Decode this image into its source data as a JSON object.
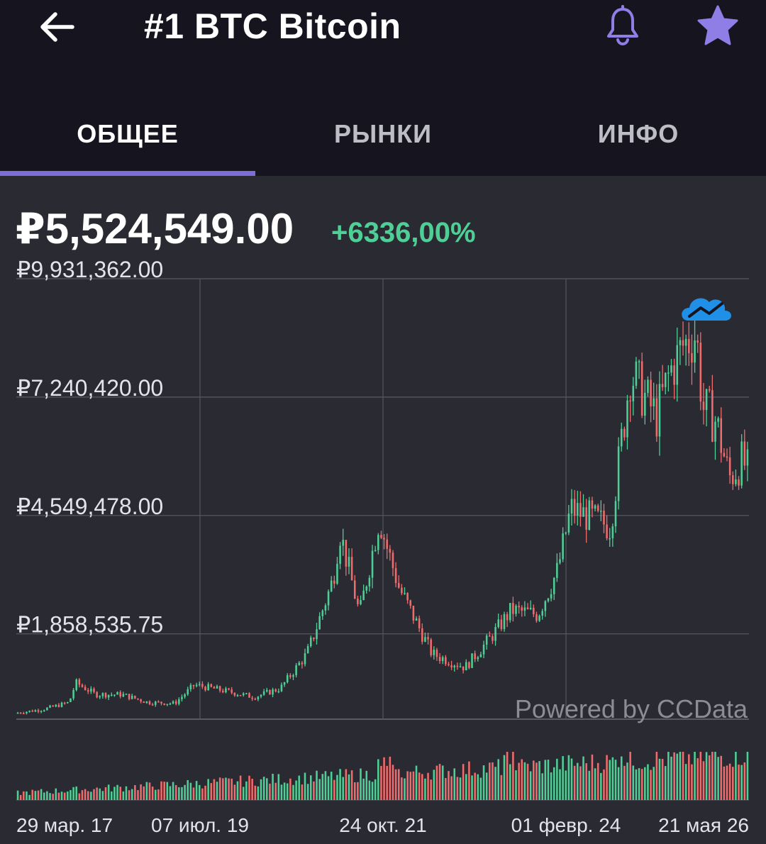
{
  "header": {
    "title": "#1 BTC Bitcoin",
    "back_icon": "arrow-left-icon",
    "alert_icon": "bell-icon",
    "favorite_icon": "star-icon"
  },
  "tabs": [
    {
      "label": "ОБЩЕЕ",
      "active": true
    },
    {
      "label": "РЫНКИ",
      "active": false
    },
    {
      "label": "ИНФО",
      "active": false
    }
  ],
  "price": {
    "current": "₽5,524,549.00",
    "change": "+6336,00%"
  },
  "colors": {
    "accent": "#7b6fd6",
    "up": "#4fcf95",
    "down": "#f06b6b",
    "background": "#2a2a33",
    "header": "#16151f"
  },
  "chart_data": {
    "type": "candlestick",
    "y_ticks": [
      "₽9,931,362.00",
      "₽7,240,420.00",
      "₽4,549,478.00",
      "₽1,858,535.75"
    ],
    "y_tick_values": [
      9931362,
      7240420,
      4549478,
      1858535.75
    ],
    "x_ticks": [
      "29 мар. 17",
      "07 июл. 19",
      "24 окт. 21",
      "01 февр. 24",
      "21 мая 26"
    ],
    "ylim": [
      -81000,
      9931362
    ],
    "x": [
      "2017-03",
      "2017-07",
      "2017-11",
      "2017-12",
      "2018-03",
      "2018-07",
      "2018-11",
      "2019-03",
      "2019-06",
      "2019-12",
      "2020-03",
      "2020-07",
      "2020-11",
      "2020-12",
      "2021-03",
      "2021-04",
      "2021-07",
      "2021-10",
      "2021-11",
      "2022-01",
      "2022-06",
      "2022-11",
      "2023-03",
      "2023-06",
      "2023-10",
      "2024-01",
      "2024-03",
      "2024-06",
      "2024-09",
      "2024-11",
      "2024-12",
      "2025-04",
      "2025-06",
      "2025-08",
      "2025-10",
      "2025-11",
      "2026-01",
      "2026-03",
      "2026-05",
      "2026-06"
    ],
    "close": [
      62000,
      140000,
      300000,
      750000,
      480000,
      480000,
      300000,
      280000,
      700000,
      520000,
      420000,
      620000,
      1400000,
      1800000,
      3100000,
      4200000,
      2300000,
      4500000,
      3900000,
      2900000,
      1400000,
      1100000,
      1800000,
      2400000,
      2300000,
      3300000,
      4700000,
      4500000,
      4300000,
      6600000,
      7800000,
      6800000,
      7800000,
      8400000,
      8700000,
      7000000,
      6700000,
      5400000,
      5800000,
      5524549
    ],
    "volume_level": "increasing over time with spikes near 2021-11, 2023-06 and 2024-11",
    "watermark": "Powered by CCData",
    "grid": true
  }
}
